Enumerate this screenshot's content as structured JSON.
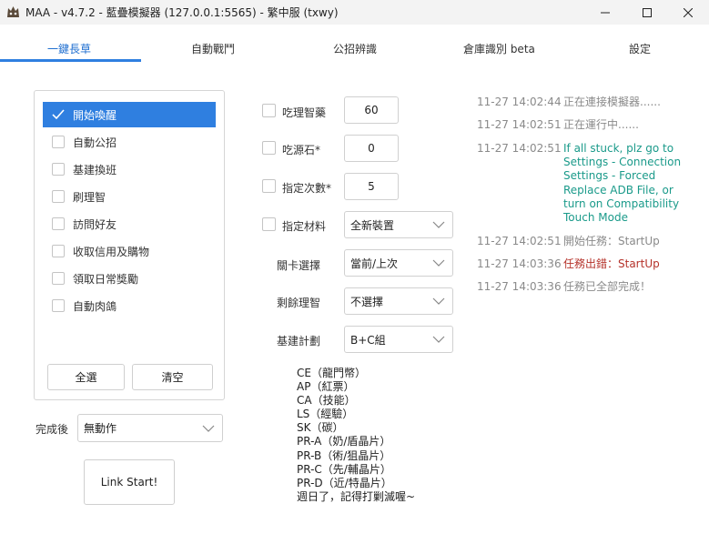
{
  "window": {
    "title": "MAA - v4.7.2 - 藍疊模擬器 (127.0.0.1:5565) - 繁中服 (txwy)",
    "icon": "maa-app-icon",
    "controls": [
      "minimize-icon",
      "maximize-icon",
      "close-icon"
    ]
  },
  "tabs": [
    {
      "label": "一鍵長草",
      "active": true
    },
    {
      "label": "自動戰鬥",
      "active": false
    },
    {
      "label": "公招辨識",
      "active": false
    },
    {
      "label": "倉庫識別 beta",
      "active": false
    },
    {
      "label": "設定",
      "active": false
    }
  ],
  "tasks": {
    "items": [
      {
        "label": "開始喚醒",
        "checked": true,
        "selected": true
      },
      {
        "label": "自動公招",
        "checked": false
      },
      {
        "label": "基建換班",
        "checked": false
      },
      {
        "label": "刷理智",
        "checked": false
      },
      {
        "label": "訪問好友",
        "checked": false
      },
      {
        "label": "收取信用及購物",
        "checked": false
      },
      {
        "label": "領取日常獎勵",
        "checked": false
      },
      {
        "label": "自動肉鴿",
        "checked": false
      }
    ],
    "select_all_label": "全選",
    "clear_label": "清空"
  },
  "after_complete": {
    "label": "完成後",
    "value": "無動作"
  },
  "link_start_label": "Link Start!",
  "settings": {
    "use_sanity_potion": {
      "label": "吃理智藥",
      "value": "60",
      "checked": false
    },
    "use_originite": {
      "label": "吃源石*",
      "value": "0",
      "checked": false
    },
    "specify_times": {
      "label": "指定次數*",
      "value": "5",
      "checked": false
    },
    "specify_material": {
      "label": "指定材料",
      "value": "全新裝置",
      "checked": false
    },
    "stage_select": {
      "label": "關卡選擇",
      "value": "當前/上次"
    },
    "remaining_sanity": {
      "label": "剩餘理智",
      "value": "不選擇"
    },
    "infrast_plan": {
      "label": "基建計劃",
      "value": "B+C組"
    }
  },
  "stage_info": [
    "CE（龍門幣）",
    "AP（紅票）",
    "CA（技能）",
    "LS（經驗）",
    "SK（碳）",
    "PR-A（奶/盾晶片）",
    "PR-B（術/狙晶片）",
    "PR-C（先/輔晶片）",
    "PR-D（近/特晶片）",
    "週日了，記得打剿滅喔~"
  ],
  "log": [
    {
      "time": "11-27  14:02:44",
      "message": "正在連接模擬器......",
      "color": "#8a8a8a"
    },
    {
      "time": "11-27  14:02:51",
      "message": "正在運行中......",
      "color": "#8a8a8a"
    },
    {
      "time": "11-27  14:02:51",
      "message": "If all stuck, plz go to Settings - Connection Settings - Forced Replace ADB File, or turn on Compatibility Touch Mode",
      "color": "#1a9a8a"
    },
    {
      "time": "11-27  14:02:51",
      "message": "開始任務：StartUp",
      "color": "#8a8a8a"
    },
    {
      "time": "11-27  14:03:36",
      "message": "任務出錯：StartUp",
      "color": "#b5322a"
    },
    {
      "time": "11-27  14:03:36",
      "message": "任務已全部完成！",
      "color": "#8a8a8a"
    }
  ],
  "colors": {
    "accent": "#2f7fe0",
    "log_info": "#8a8a8a",
    "log_warning": "#1a9a8a",
    "log_error": "#b5322a"
  }
}
